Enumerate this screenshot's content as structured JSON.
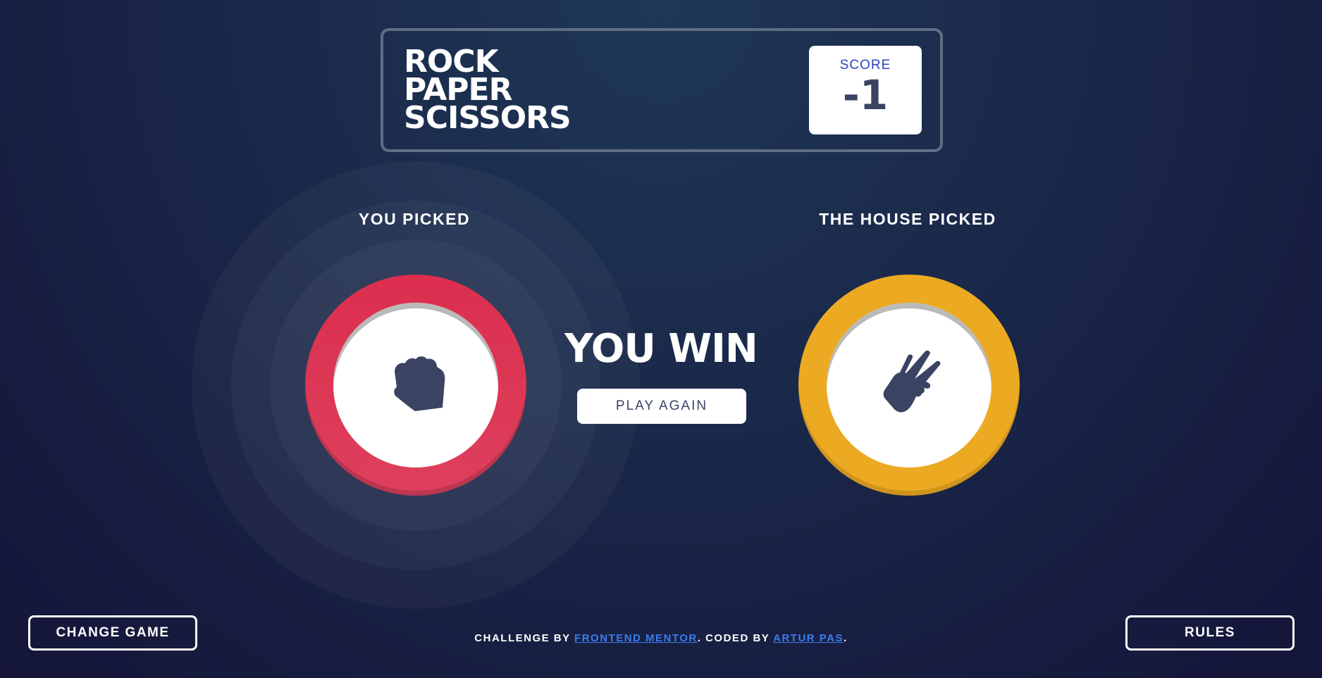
{
  "header": {
    "title_lines": [
      "ROCK",
      "PAPER",
      "SCISSORS"
    ],
    "score_label": "SCORE",
    "score_value": "-1"
  },
  "picks": {
    "user_label": "YOU PICKED",
    "house_label": "THE HOUSE PICKED",
    "user_choice": "rock-icon",
    "house_choice": "scissors-icon"
  },
  "result": {
    "text": "YOU WIN",
    "play_again_label": "PLAY AGAIN"
  },
  "buttons": {
    "change_game_label": "CHANGE GAME",
    "rules_label": "RULES"
  },
  "footer": {
    "prefix": "CHALLENGE BY ",
    "link1": "FRONTEND MENTOR",
    "middle": ". CODED BY ",
    "link2": "ARTUR PAS",
    "suffix": "."
  },
  "colors": {
    "rock": "#dc2e4e",
    "scissors": "#eca922",
    "icon": "#3b4363"
  }
}
